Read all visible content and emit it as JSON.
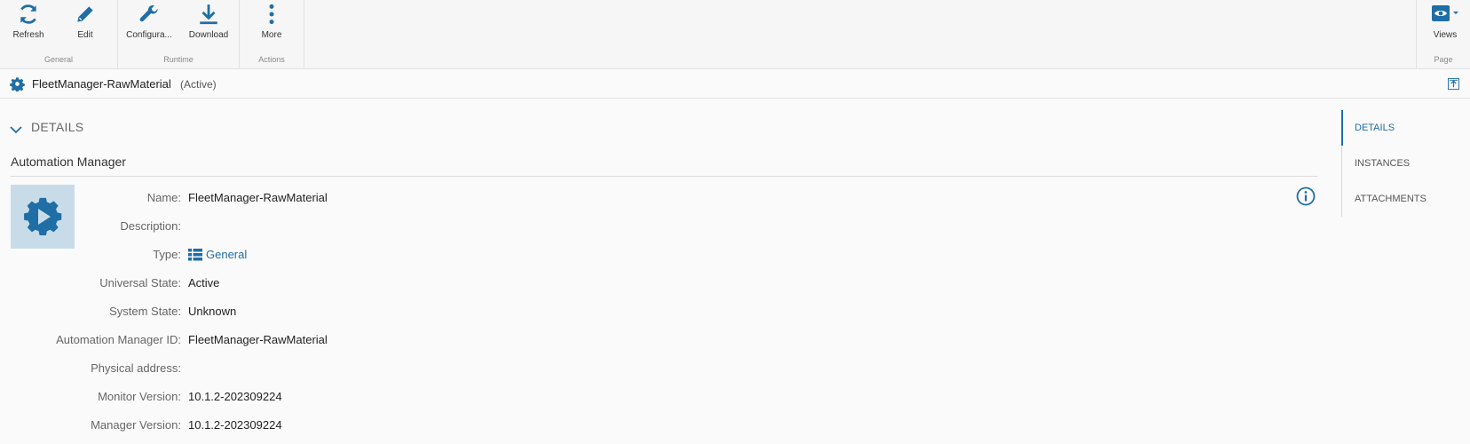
{
  "ribbon": {
    "groups": {
      "general": "General",
      "runtime": "Runtime",
      "actions": "Actions",
      "page": "Page"
    },
    "buttons": {
      "refresh": "Refresh",
      "edit": "Edit",
      "configure": "Configura...",
      "download": "Download",
      "more": "More",
      "views": "Views"
    }
  },
  "titlebar": {
    "name": "FleetManager-RawMaterial",
    "status": "(Active)"
  },
  "details": {
    "section_title": "DETAILS",
    "subtitle": "Automation Manager",
    "fields": [
      {
        "label": "Name:",
        "value": "FleetManager-RawMaterial"
      },
      {
        "label": "Description:",
        "value": ""
      },
      {
        "label": "Type:",
        "value": "General"
      },
      {
        "label": "Universal State:",
        "value": "Active"
      },
      {
        "label": "System State:",
        "value": "Unknown"
      },
      {
        "label": "Automation Manager ID:",
        "value": "FleetManager-RawMaterial"
      },
      {
        "label": "Physical address:",
        "value": ""
      },
      {
        "label": "Monitor Version:",
        "value": "10.1.2-202309224"
      },
      {
        "label": "Manager Version:",
        "value": "10.1.2-202309224"
      }
    ]
  },
  "side_nav": {
    "items": [
      "DETAILS",
      "INSTANCES",
      "ATTACHMENTS"
    ]
  },
  "colors": {
    "accent": "#1f6ea5",
    "icon_tile": "#c7dce8"
  },
  "icons": [
    "refresh-icon",
    "edit-icon",
    "wrench-icon",
    "download-icon",
    "more-icon",
    "eye-icon",
    "gear-icon",
    "expand-icon",
    "chevron-down-icon",
    "info-icon",
    "list-icon"
  ]
}
